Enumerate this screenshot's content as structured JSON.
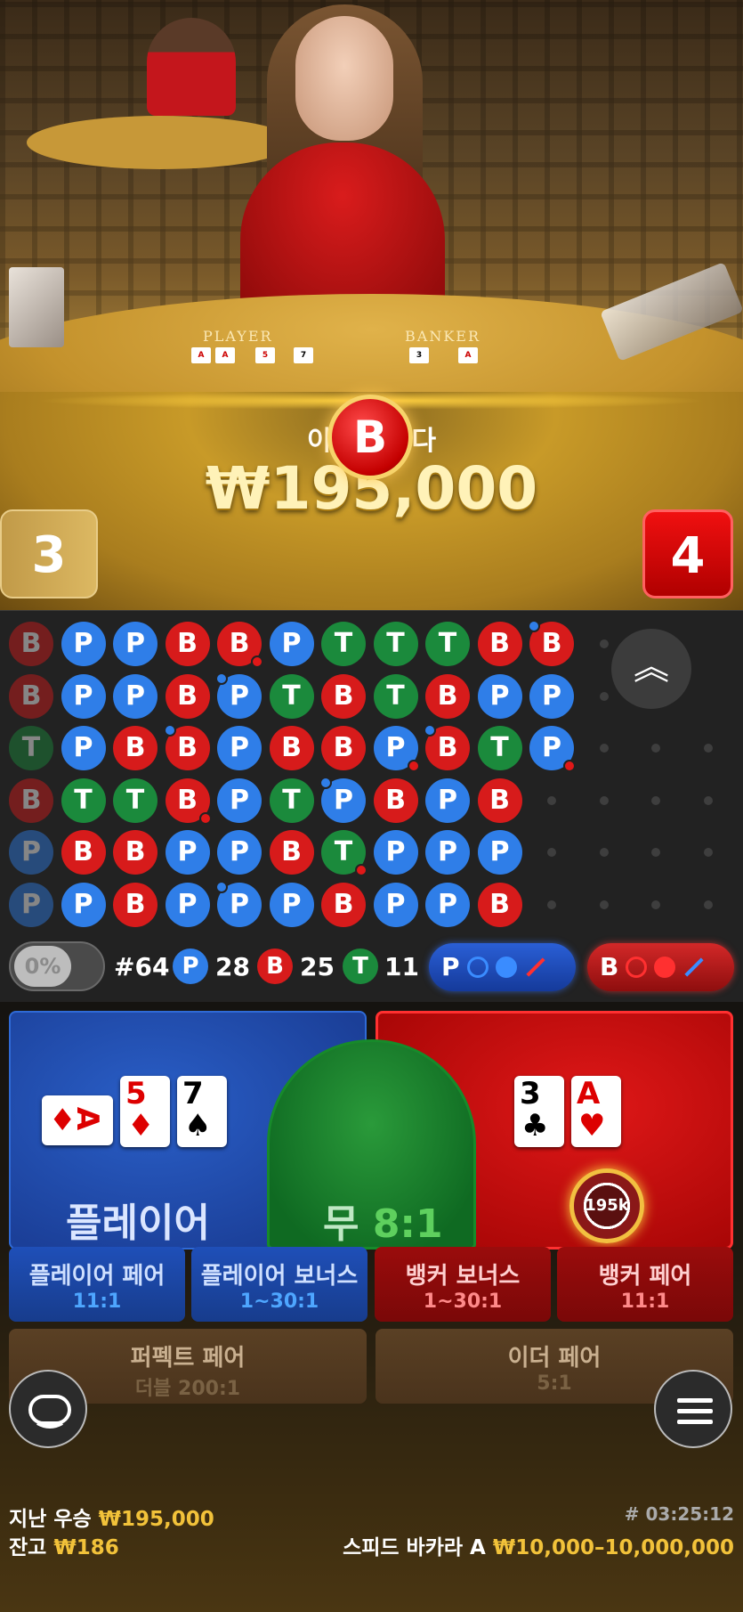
{
  "video": {
    "felt_player_label": "PLAYER",
    "felt_banker_label": "BANKER"
  },
  "result": {
    "win_label": "이겼습니다",
    "win_label_visible_left": "이",
    "win_label_visible_right": "다",
    "win_amount": "₩195,000",
    "winner_marker": "B",
    "player_score": "3",
    "banker_score": "4"
  },
  "roadmap": {
    "rows": [
      [
        "B",
        "P",
        "P",
        "B",
        "B",
        "P",
        "T",
        "T",
        "T",
        "B",
        "B"
      ],
      [
        "B",
        "P",
        "P",
        "B",
        "P",
        "T",
        "B",
        "T",
        "B",
        "P",
        "P"
      ],
      [
        "T",
        "P",
        "B",
        "B",
        "P",
        "B",
        "B",
        "P",
        "B",
        "T",
        "P"
      ],
      [
        "B",
        "T",
        "T",
        "B",
        "P",
        "T",
        "P",
        "B",
        "P",
        "B"
      ],
      [
        "P",
        "B",
        "B",
        "P",
        "P",
        "B",
        "T",
        "P",
        "P",
        "P"
      ],
      [
        "P",
        "P",
        "B",
        "P",
        "P",
        "P",
        "B",
        "P",
        "P",
        "B"
      ]
    ],
    "expand_icon": "double-chevron-up-icon"
  },
  "stats": {
    "toggle_percent": "0%",
    "shoe_count": "#64",
    "player_symbol": "P",
    "player_count": "28",
    "banker_symbol": "B",
    "banker_count": "25",
    "tie_symbol": "T",
    "tie_count": "11",
    "predict_player_label": "P",
    "predict_banker_label": "B"
  },
  "bets": {
    "player_label": "플레이어",
    "tie_label": "무",
    "tie_odds": "8:1",
    "player_cards": [
      {
        "rank": "A",
        "suit": "♦",
        "red": true
      },
      {
        "rank": "5",
        "suit": "♦",
        "red": true
      },
      {
        "rank": "7",
        "suit": "♠",
        "red": false
      }
    ],
    "banker_cards": [
      {
        "rank": "3",
        "suit": "♣",
        "red": false
      },
      {
        "rank": "A",
        "suit": "♥",
        "red": true
      }
    ],
    "chip_label": "195k",
    "side_bets": [
      {
        "name": "플레이어 페어",
        "odds": "11:1"
      },
      {
        "name": "플레이어 보너스",
        "odds": "1~30:1"
      },
      {
        "name": "뱅커 보너스",
        "odds": "1~30:1"
      },
      {
        "name": "뱅커 페어",
        "odds": "11:1"
      },
      {
        "name": "퍼펙트 페어",
        "odds": "더블 200:1"
      },
      {
        "name": "이더 페어",
        "odds": "5:1"
      }
    ]
  },
  "footer": {
    "last_win_label": "지난 우승",
    "last_win_value": "₩195,000",
    "balance_label": "잔고",
    "balance_value": "₩186",
    "round_id": "# 03:25:12",
    "table_name": "스피드 바카라 A",
    "bet_limits": "₩10,000–10,000,000",
    "chat_icon": "chat-bubble-icon",
    "menu_icon": "hamburger-menu-icon"
  }
}
